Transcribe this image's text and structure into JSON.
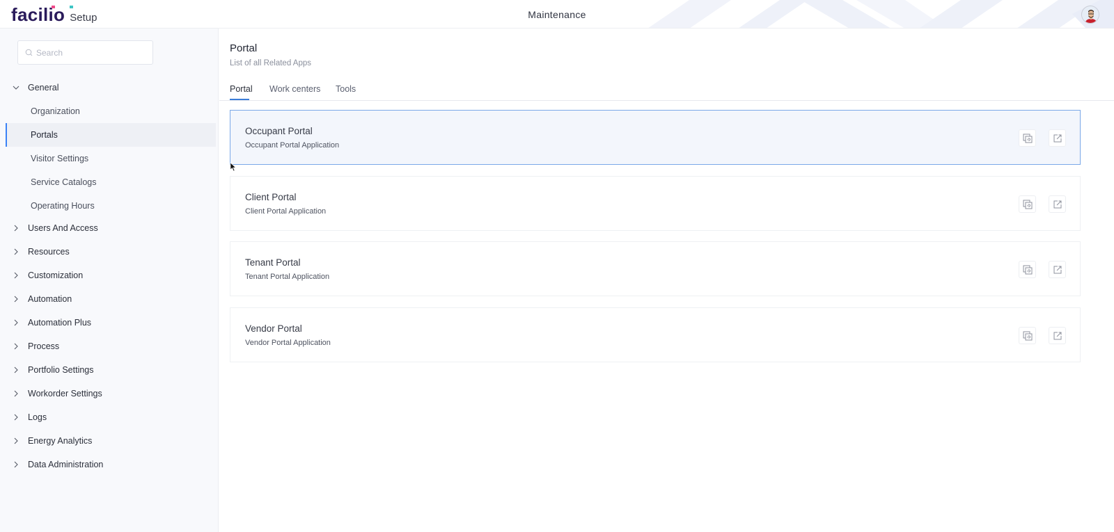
{
  "header": {
    "logo_text": "facilio",
    "logo_suffix": "Setup",
    "app_title": "Maintenance",
    "avatar": "user-avatar",
    "colors": {
      "logo": "#2a1b5b",
      "logo_dot_pink": "#ef4a8a",
      "logo_dot_teal": "#3ec5c5"
    }
  },
  "sidebar": {
    "search_placeholder": "Search",
    "search_value": "",
    "groups": [
      {
        "label": "General",
        "expanded": true,
        "children": [
          {
            "label": "Organization",
            "active": false
          },
          {
            "label": "Portals",
            "active": true
          },
          {
            "label": "Visitor Settings",
            "active": false
          },
          {
            "label": "Service Catalogs",
            "active": false
          },
          {
            "label": "Operating Hours",
            "active": false
          }
        ]
      },
      {
        "label": "Users And Access",
        "expanded": false
      },
      {
        "label": "Resources",
        "expanded": false
      },
      {
        "label": "Customization",
        "expanded": false
      },
      {
        "label": "Automation",
        "expanded": false
      },
      {
        "label": "Automation Plus",
        "expanded": false
      },
      {
        "label": "Process",
        "expanded": false
      },
      {
        "label": "Portfolio Settings",
        "expanded": false
      },
      {
        "label": "Workorder Settings",
        "expanded": false
      },
      {
        "label": "Logs",
        "expanded": false
      },
      {
        "label": "Energy Analytics",
        "expanded": false
      },
      {
        "label": "Data Administration",
        "expanded": false
      }
    ]
  },
  "main": {
    "title": "Portal",
    "subtitle": "List of all Related Apps",
    "tabs": [
      {
        "label": "Portal",
        "active": true
      },
      {
        "label": "Work centers",
        "active": false
      },
      {
        "label": "Tools",
        "active": false
      }
    ],
    "portals": [
      {
        "name": "Occupant Portal",
        "description": "Occupant Portal Application",
        "selected": true
      },
      {
        "name": "Client Portal",
        "description": "Client Portal Application",
        "selected": false
      },
      {
        "name": "Tenant Portal",
        "description": "Tenant Portal Application",
        "selected": false
      },
      {
        "name": "Vendor Portal",
        "description": "Vendor Portal Application",
        "selected": false
      }
    ],
    "card_actions": [
      "copy-link-icon",
      "open-external-icon"
    ],
    "accent_color": "#3b7dd8"
  }
}
